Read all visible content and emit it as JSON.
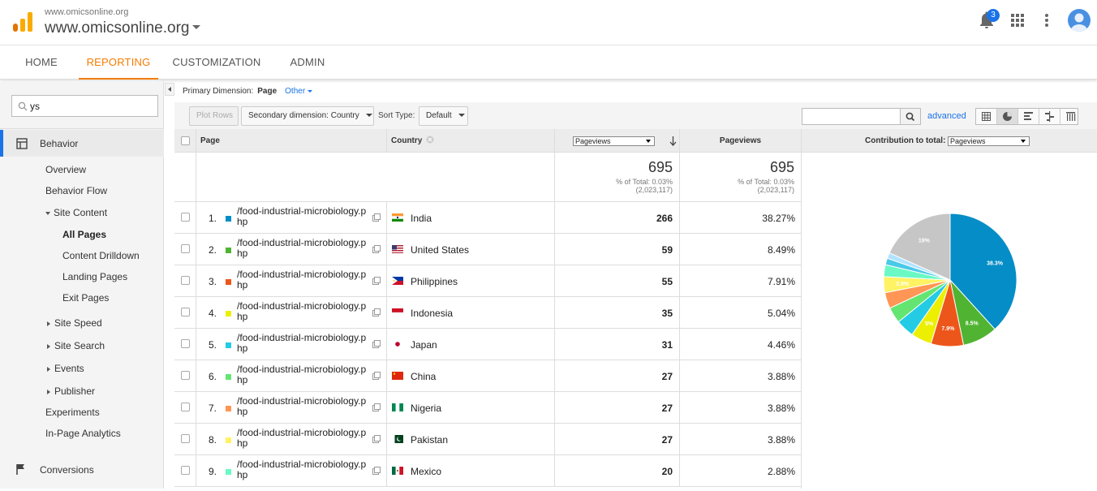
{
  "header": {
    "site_small": "www.omicsonline.org",
    "site_big": "www.omicsonline.org",
    "notification_count": "3"
  },
  "nav": {
    "tabs": [
      {
        "label": "HOME",
        "active": false
      },
      {
        "label": "REPORTING",
        "active": true
      },
      {
        "label": "CUSTOMIZATION",
        "active": false
      },
      {
        "label": "ADMIN",
        "active": false
      }
    ]
  },
  "sidebar": {
    "search_value": "ys",
    "behavior": "Behavior",
    "items": [
      {
        "label": "Overview",
        "level": 1
      },
      {
        "label": "Behavior Flow",
        "level": 1
      },
      {
        "label": "Site Content",
        "level": 1,
        "expanded": true
      },
      {
        "label": "All Pages",
        "level": 2,
        "active": true
      },
      {
        "label": "Content Drilldown",
        "level": 2
      },
      {
        "label": "Landing Pages",
        "level": 2
      },
      {
        "label": "Exit Pages",
        "level": 2
      },
      {
        "label": "Site Speed",
        "level": 1,
        "collapsed": true
      },
      {
        "label": "Site Search",
        "level": 1,
        "collapsed": true
      },
      {
        "label": "Events",
        "level": 1,
        "collapsed": true
      },
      {
        "label": "Publisher",
        "level": 1,
        "collapsed": true
      },
      {
        "label": "Experiments",
        "level": 1
      },
      {
        "label": "In-Page Analytics",
        "level": 1
      }
    ],
    "conversions": "Conversions"
  },
  "report": {
    "primary_dimension_label": "Primary Dimension:",
    "primary_dimension_value": "Page",
    "other_label": "Other",
    "plot_rows": "Plot Rows",
    "secondary_dimension": "Secondary dimension: Country",
    "sort_type_label": "Sort Type:",
    "sort_type_value": "Default",
    "advanced": "advanced"
  },
  "table": {
    "headers": {
      "page": "Page",
      "country": "Country",
      "metric_select": "Pageviews",
      "pageviews": "Pageviews",
      "contribution": "Contribution to total:",
      "contribution_select": "Pageviews"
    },
    "totals": {
      "value1": "695",
      "sub1a": "% of Total: 0.03%",
      "sub1b": "(2,023,117)",
      "value2": "695",
      "sub2a": "% of Total: 0.03%",
      "sub2b": "(2,023,117)"
    },
    "rows": [
      {
        "rank": "1.",
        "page": "/food-industrial-microbiology.php",
        "country": "India",
        "flag": "india",
        "pageviews": "266",
        "pct": "38.27%",
        "color": "#058dc7"
      },
      {
        "rank": "2.",
        "page": "/food-industrial-microbiology.php",
        "country": "United States",
        "flag": "us",
        "pageviews": "59",
        "pct": "8.49%",
        "color": "#50b432"
      },
      {
        "rank": "3.",
        "page": "/food-industrial-microbiology.php",
        "country": "Philippines",
        "flag": "ph",
        "pageviews": "55",
        "pct": "7.91%",
        "color": "#ed561b"
      },
      {
        "rank": "4.",
        "page": "/food-industrial-microbiology.php",
        "country": "Indonesia",
        "flag": "id",
        "pageviews": "35",
        "pct": "5.04%",
        "color": "#edef00"
      },
      {
        "rank": "5.",
        "page": "/food-industrial-microbiology.php",
        "country": "Japan",
        "flag": "jp",
        "pageviews": "31",
        "pct": "4.46%",
        "color": "#24cbe5"
      },
      {
        "rank": "6.",
        "page": "/food-industrial-microbiology.php",
        "country": "China",
        "flag": "cn",
        "pageviews": "27",
        "pct": "3.88%",
        "color": "#64e572"
      },
      {
        "rank": "7.",
        "page": "/food-industrial-microbiology.php",
        "country": "Nigeria",
        "flag": "ng",
        "pageviews": "27",
        "pct": "3.88%",
        "color": "#ff9655"
      },
      {
        "rank": "8.",
        "page": "/food-industrial-microbiology.php",
        "country": "Pakistan",
        "flag": "pk",
        "pageviews": "27",
        "pct": "3.88%",
        "color": "#fff263"
      },
      {
        "rank": "9.",
        "page": "/food-industrial-microbiology.php",
        "country": "Mexico",
        "flag": "mx",
        "pageviews": "20",
        "pct": "2.88%",
        "color": "#6af9c4"
      }
    ]
  },
  "chart_data": {
    "type": "pie",
    "slices": [
      {
        "label": "38.3%",
        "value": 38.27,
        "color": "#058dc7"
      },
      {
        "label": "8.5%",
        "value": 8.49,
        "color": "#50b432"
      },
      {
        "label": "7.9%",
        "value": 7.91,
        "color": "#ed561b"
      },
      {
        "label": "5%",
        "value": 5.04,
        "color": "#edef00"
      },
      {
        "label": "",
        "value": 4.46,
        "color": "#24cbe5"
      },
      {
        "label": "",
        "value": 3.88,
        "color": "#64e572"
      },
      {
        "label": "",
        "value": 3.88,
        "color": "#ff9655"
      },
      {
        "label": "3.9%",
        "value": 3.88,
        "color": "#fff263"
      },
      {
        "label": "",
        "value": 2.88,
        "color": "#6af9c4"
      },
      {
        "label": "",
        "value": 1.6,
        "color": "#4ac9e9"
      },
      {
        "label": "",
        "value": 1.4,
        "color": "#b0e3ff"
      },
      {
        "label": "19%",
        "value": 18.31,
        "color": "#c6c6c6"
      }
    ]
  }
}
